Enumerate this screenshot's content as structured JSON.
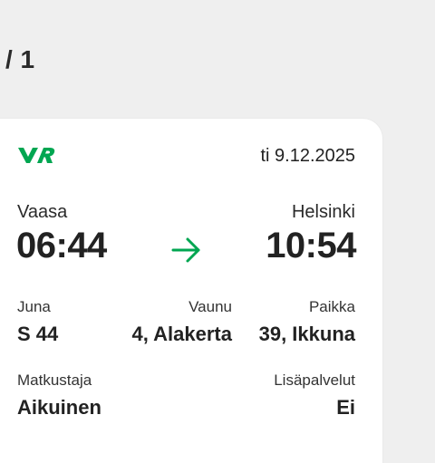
{
  "pagination": {
    "text": "/ 1"
  },
  "ticket": {
    "date": "ti 9.12.2025",
    "departure": {
      "station": "Vaasa",
      "time": "06:44"
    },
    "arrival": {
      "station": "Helsinki",
      "time": "10:54"
    },
    "train": {
      "label": "Juna",
      "value": "S 44"
    },
    "car": {
      "label": "Vaunu",
      "value": "4, Alakerta"
    },
    "seat": {
      "label": "Paikka",
      "value": "39, Ikkuna"
    },
    "passenger": {
      "label": "Matkustaja",
      "value": "Aikuinen"
    },
    "extras": {
      "label": "Lisäpalvelut",
      "value": "Ei"
    }
  },
  "colors": {
    "brand_green": "#00a651",
    "background": "#efefef",
    "card": "#ffffff"
  },
  "icons": {
    "logo": "vr-logo",
    "arrow": "arrow-right-icon"
  }
}
